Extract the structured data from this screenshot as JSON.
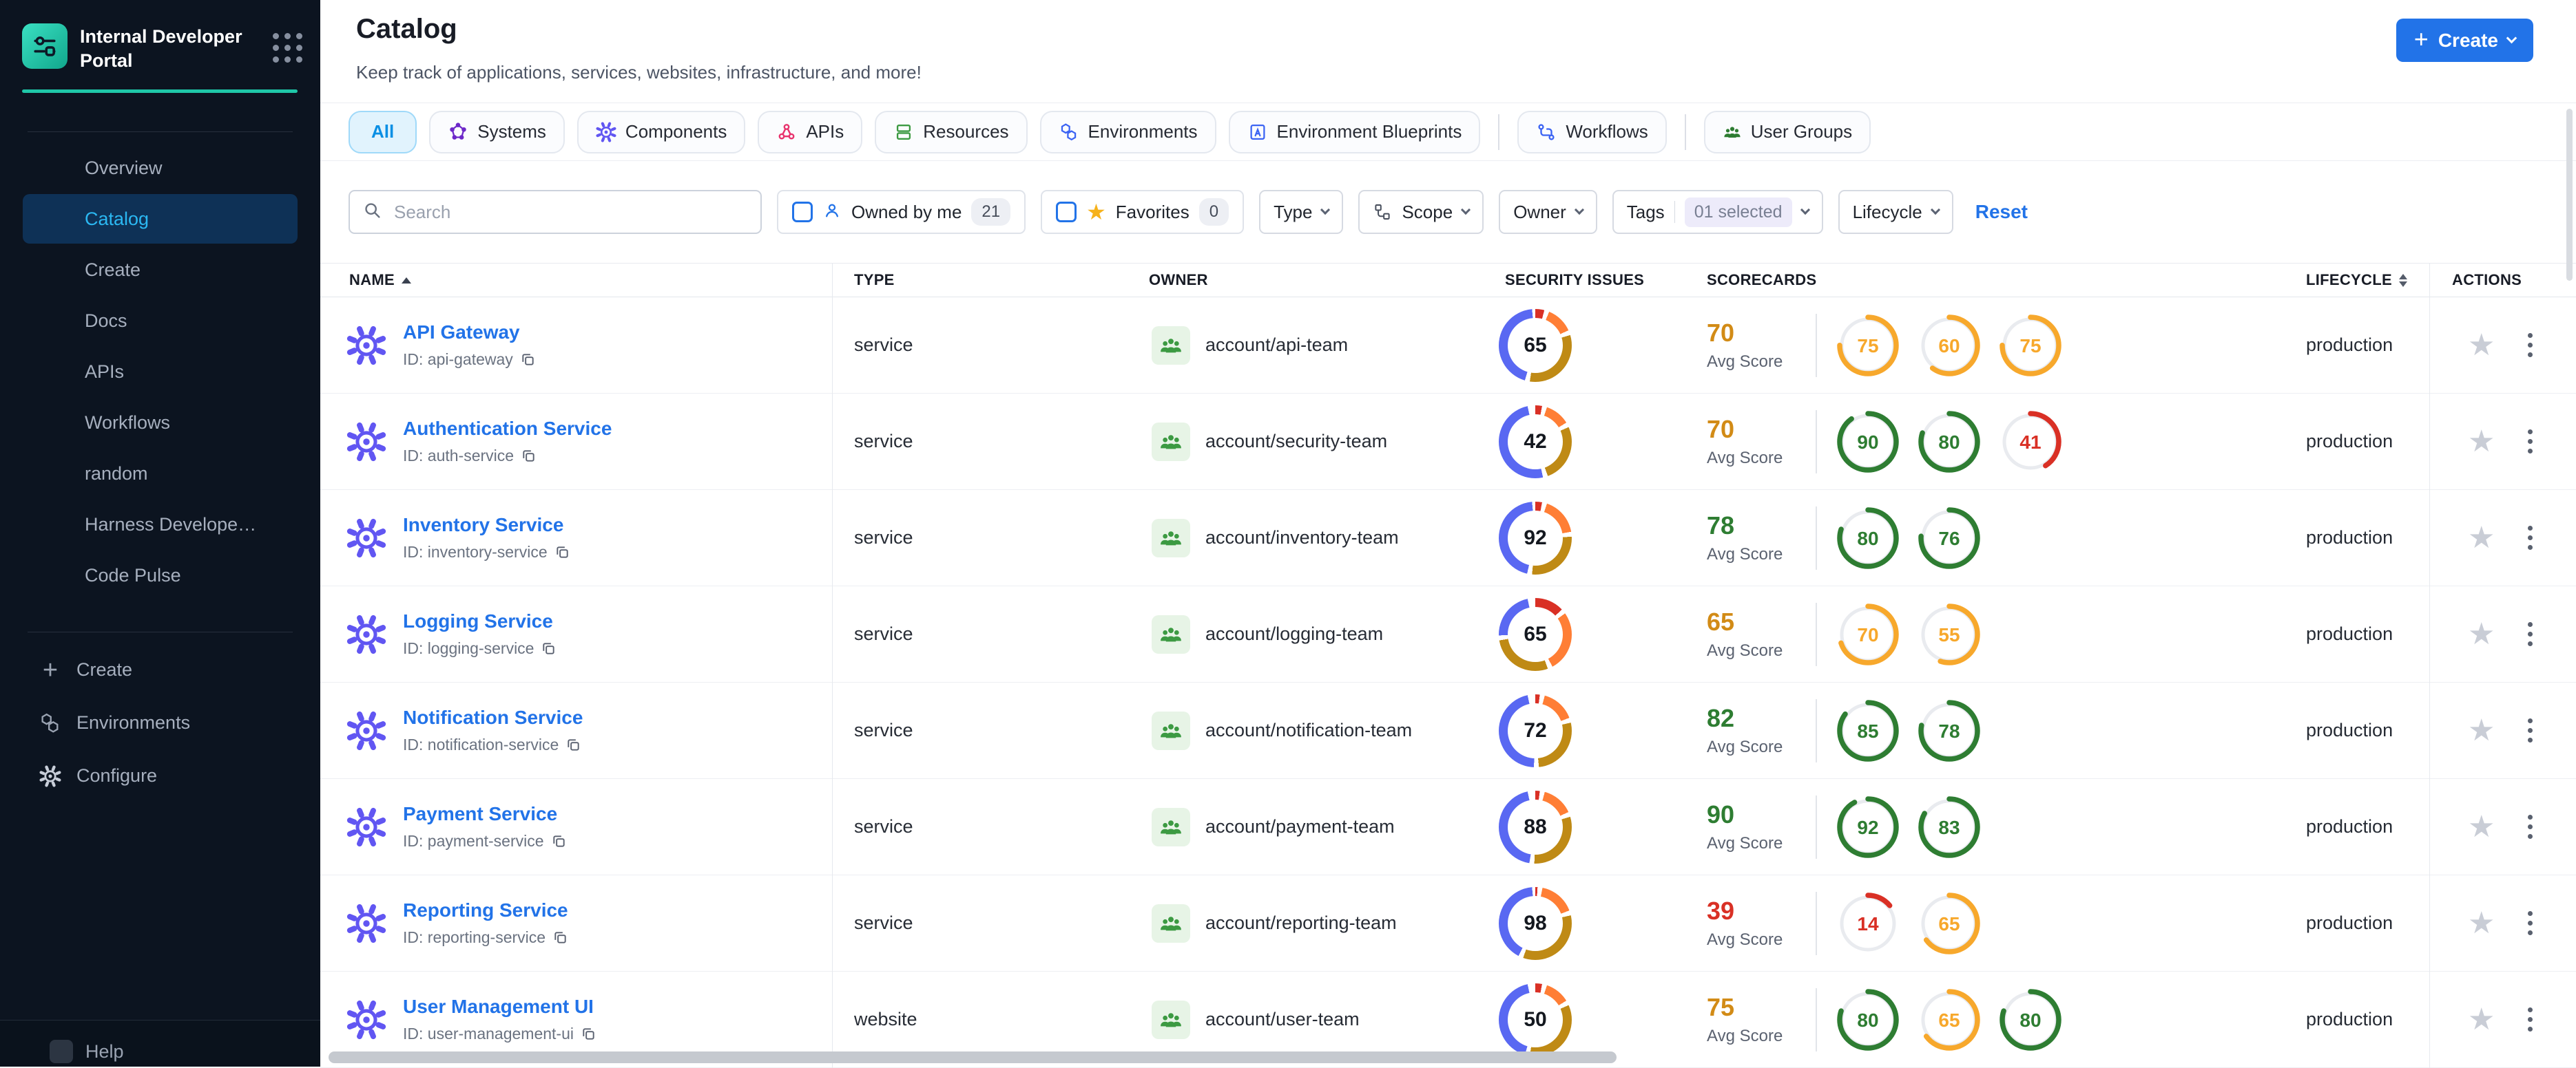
{
  "theme": {
    "sidebar_bg": "#0c1420",
    "sidebar_footer_bg": "#0a121c",
    "sidebar_active_bg": "#0e3156",
    "sidebar_active_text": "#2bb8f2",
    "sidebar_text": "#a6afbe",
    "teal": "#1fc7a8",
    "blue": "#2273e8",
    "tab_active_bg": "#e1f3fd",
    "tab_active_border": "#9fd9f9",
    "tab_active_text": "#0a8fe4",
    "green": "#2e7d32",
    "orange": "#f7a82c",
    "red": "#d93025",
    "gold": "#bf8a15",
    "seg_blue": "#5968f2",
    "seg_orange": "#ff7e35",
    "avg_orange": "#d28b16",
    "icon_indigo": "#6156f2",
    "icon_purple": "#6d28c9",
    "icon_pink": "#e8336d",
    "icon_green": "#3c9a42",
    "icon_blue": "#3b63f3",
    "text_dark": "#181c26",
    "text_mid": "#4d5565"
  },
  "brand": {
    "title": "Internal Developer Portal"
  },
  "sidebar": {
    "items": [
      "Overview",
      "Catalog",
      "Create",
      "Docs",
      "APIs",
      "Workflows",
      "random",
      "Harness Develope…",
      "Code Pulse"
    ],
    "active_index": 1,
    "bottom_items": [
      {
        "icon": "plus",
        "label": "Create"
      },
      {
        "icon": "hexagons",
        "label": "Environments"
      },
      {
        "icon": "gear",
        "label": "Configure"
      }
    ],
    "footer_item": {
      "label": "Help"
    }
  },
  "header": {
    "title": "Catalog",
    "subtitle": "Keep track of applications, services, websites, infrastructure, and more!",
    "create_label": "Create"
  },
  "tabs": [
    {
      "label": "All",
      "active": true
    },
    {
      "label": "Systems",
      "icon": "systems"
    },
    {
      "label": "Components",
      "icon": "components"
    },
    {
      "label": "APIs",
      "icon": "apis"
    },
    {
      "label": "Resources",
      "icon": "resources"
    },
    {
      "label": "Environments",
      "icon": "environments"
    },
    {
      "label": "Environment Blueprints",
      "icon": "blueprints"
    },
    {
      "label": "Workflows",
      "icon": "workflows",
      "divider_before": true
    },
    {
      "label": "User Groups",
      "icon": "usergroups",
      "divider_before": true
    }
  ],
  "filters": {
    "search_placeholder": "Search",
    "owned": {
      "label": "Owned by me",
      "count": "21"
    },
    "favorites": {
      "label": "Favorites",
      "count": "0"
    },
    "dropdowns": [
      {
        "label": "Type"
      },
      {
        "label": "Scope",
        "icon": "scope"
      },
      {
        "label": "Owner"
      },
      {
        "label": "Tags",
        "value": "01 selected"
      },
      {
        "label": "Lifecycle"
      }
    ],
    "reset_label": "Reset"
  },
  "table": {
    "columns": [
      "NAME",
      "TYPE",
      "OWNER",
      "SECURITY ISSUES",
      "SCORECARDS",
      "LIFECYCLE",
      "ACTIONS"
    ],
    "avg_label": "Avg Score",
    "id_prefix": "ID:",
    "rows": [
      {
        "name": "API Gateway",
        "id": "api-gateway",
        "type": "service",
        "owner": "account/api-team",
        "security": 65,
        "segments": [
          4,
          12,
          32,
          44
        ],
        "avg": 70,
        "scorecards": [
          75,
          60,
          75
        ],
        "lifecycle": "production"
      },
      {
        "name": "Authentication Service",
        "id": "auth-service",
        "type": "service",
        "owner": "account/security-team",
        "security": 42,
        "segments": [
          3,
          11,
          26,
          50
        ],
        "avg": 70,
        "scorecards": [
          90,
          80,
          41
        ],
        "lifecycle": "production"
      },
      {
        "name": "Inventory Service",
        "id": "inventory-service",
        "type": "service",
        "owner": "account/inventory-team",
        "security": 92,
        "segments": [
          3,
          17,
          27,
          45
        ],
        "avg": 78,
        "scorecards": [
          80,
          76
        ],
        "lifecycle": "production"
      },
      {
        "name": "Logging Service",
        "id": "logging-service",
        "type": "service",
        "owner": "account/logging-team",
        "security": 65,
        "segments": [
          13,
          27,
          28,
          22
        ],
        "avg": 65,
        "scorecards": [
          70,
          55
        ],
        "lifecycle": "production"
      },
      {
        "name": "Notification Service",
        "id": "notification-service",
        "type": "service",
        "owner": "account/notification-team",
        "security": 72,
        "segments": [
          2,
          15,
          27,
          46
        ],
        "avg": 82,
        "scorecards": [
          85,
          78
        ],
        "lifecycle": "production"
      },
      {
        "name": "Payment Service",
        "id": "payment-service",
        "type": "service",
        "owner": "account/payment-team",
        "security": 88,
        "segments": [
          2,
          14,
          30,
          44
        ],
        "avg": 90,
        "scorecards": [
          92,
          83
        ],
        "lifecycle": "production"
      },
      {
        "name": "Reporting Service",
        "id": "reporting-service",
        "type": "service",
        "owner": "account/reporting-team",
        "security": 98,
        "segments": [
          1,
          16,
          34,
          41
        ],
        "avg": 39,
        "scorecards": [
          14,
          65
        ],
        "lifecycle": "production"
      },
      {
        "name": "User Management UI",
        "id": "user-management-ui",
        "type": "website",
        "owner": "account/user-team",
        "security": 50,
        "segments": [
          3,
          11,
          34,
          42
        ],
        "avg": 75,
        "scorecards": [
          80,
          65,
          80
        ],
        "lifecycle": "production"
      }
    ]
  }
}
